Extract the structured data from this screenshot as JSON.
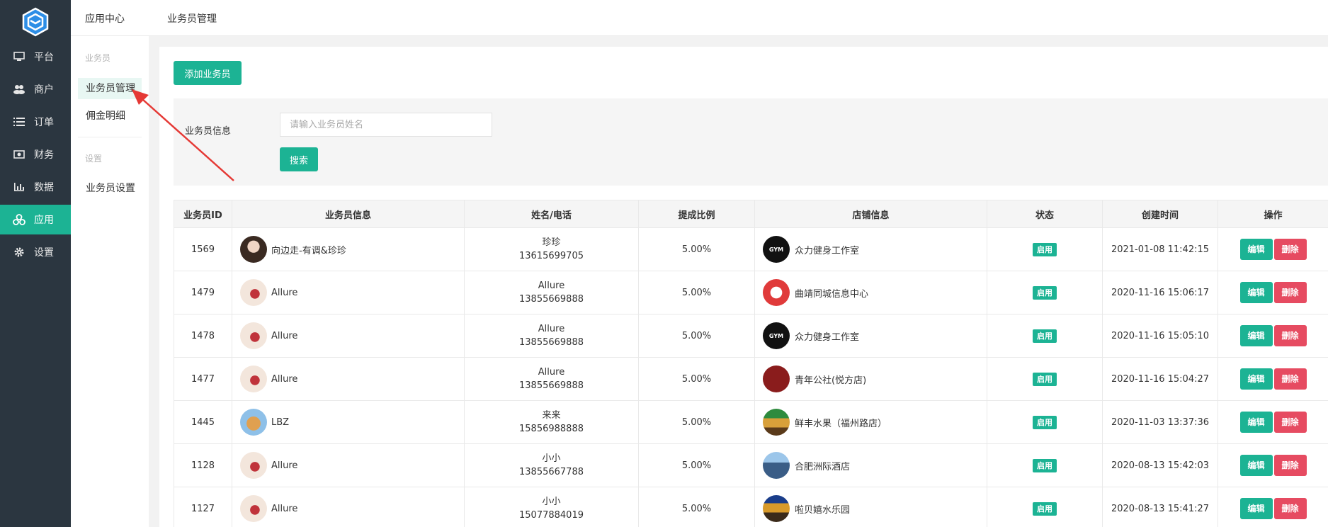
{
  "topbar": {
    "title": "应用中心",
    "page": "业务员管理"
  },
  "nav": [
    {
      "label": "平台",
      "icon": "monitor-icon"
    },
    {
      "label": "商户",
      "icon": "users-icon"
    },
    {
      "label": "订单",
      "icon": "list-icon"
    },
    {
      "label": "财务",
      "icon": "money-icon"
    },
    {
      "label": "数据",
      "icon": "bar-chart-icon"
    },
    {
      "label": "应用",
      "icon": "apps-icon",
      "active": true
    },
    {
      "label": "设置",
      "icon": "gear-icon"
    }
  ],
  "subnav": {
    "group1": "业务员",
    "items1": [
      "业务员管理",
      "佣金明细"
    ],
    "group2": "设置",
    "items2": [
      "业务员设置"
    ]
  },
  "toolbar": {
    "add_label": "添加业务员"
  },
  "filter": {
    "label": "业务员信息",
    "placeholder": "请输入业务员姓名",
    "search_label": "搜索"
  },
  "table": {
    "headers": [
      "业务员ID",
      "业务员信息",
      "姓名/电话",
      "提成比例",
      "店铺信息",
      "状态",
      "创建时间",
      "操作"
    ],
    "rows": [
      {
        "id": "1569",
        "user": "向边走-有调&珍珍",
        "name": "珍珍",
        "phone": "13615699705",
        "rate": "5.00%",
        "shop": "众力健身工作室",
        "status": "启用",
        "time": "2021-01-08 11:42:15"
      },
      {
        "id": "1479",
        "user": "Allure",
        "name": "Allure",
        "phone": "13855669888",
        "rate": "5.00%",
        "shop": "曲靖同城信息中心",
        "status": "启用",
        "time": "2020-11-16 15:06:17"
      },
      {
        "id": "1478",
        "user": "Allure",
        "name": "Allure",
        "phone": "13855669888",
        "rate": "5.00%",
        "shop": "众力健身工作室",
        "status": "启用",
        "time": "2020-11-16 15:05:10"
      },
      {
        "id": "1477",
        "user": "Allure",
        "name": "Allure",
        "phone": "13855669888",
        "rate": "5.00%",
        "shop": "青年公社(悦方店)",
        "status": "启用",
        "time": "2020-11-16 15:04:27"
      },
      {
        "id": "1445",
        "user": "LBZ",
        "name": "来来",
        "phone": "15856988888",
        "rate": "5.00%",
        "shop": "鲜丰水果（福州路店）",
        "status": "启用",
        "time": "2020-11-03 13:37:36"
      },
      {
        "id": "1128",
        "user": "Allure",
        "name": "小小",
        "phone": "13855667788",
        "rate": "5.00%",
        "shop": "合肥洲际酒店",
        "status": "启用",
        "time": "2020-08-13 15:42:03"
      },
      {
        "id": "1127",
        "user": "Allure",
        "name": "小小",
        "phone": "15077884019",
        "rate": "5.00%",
        "shop": "啦贝嬉水乐园",
        "status": "启用",
        "time": "2020-08-13 15:41:27"
      }
    ],
    "edit_label": "编辑",
    "delete_label": "删除"
  },
  "colors": {
    "accent": "#1cb394",
    "danger": "#e64b61",
    "sidebar": "#2b3640"
  }
}
